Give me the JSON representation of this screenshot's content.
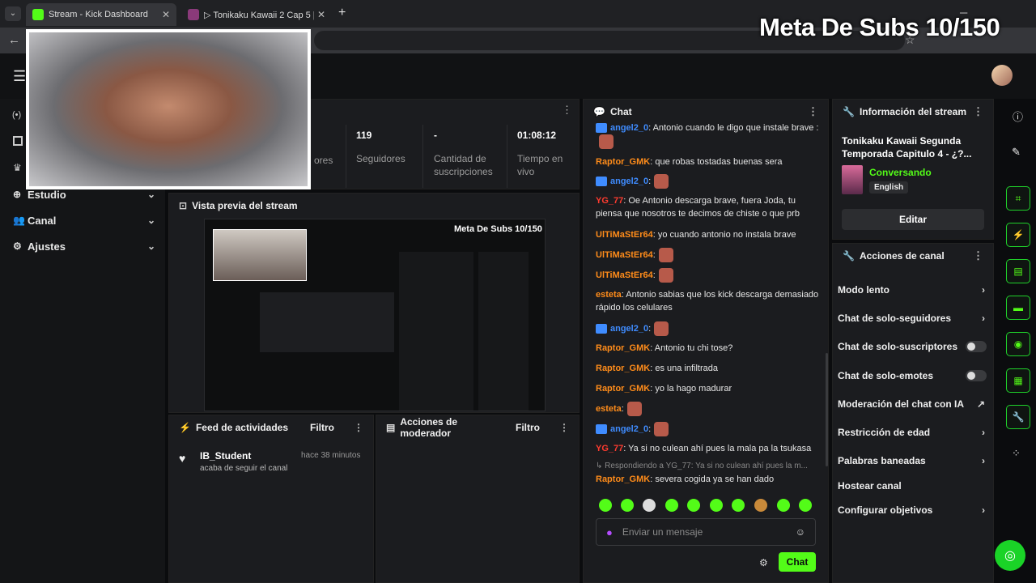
{
  "browser": {
    "tabs": [
      {
        "label": "Stream - Kick Dashboard"
      },
      {
        "label": "▷ Tonikaku Kawaii 2 Cap 5 [JAI"
      }
    ],
    "new_tab": "+"
  },
  "overlay": {
    "goal": "Meta De Subs 10/150"
  },
  "sidebar": {
    "items": [
      {
        "label": "Estudio"
      },
      {
        "label": "Canal"
      },
      {
        "label": "Ajustes"
      }
    ]
  },
  "stats": [
    {
      "value": "",
      "label": "ores"
    },
    {
      "value": "119",
      "label": "Seguidores"
    },
    {
      "value": "-",
      "label": "Cantidad de suscripciones"
    },
    {
      "value": "01:08:12",
      "label": "Tiempo en vivo"
    }
  ],
  "preview": {
    "title": "Vista previa del stream",
    "mini_goal": "Meta De Subs 10/150"
  },
  "activity": {
    "title": "Feed de actividades",
    "filter": "Filtro",
    "user": "IB_Student",
    "action": "acaba de seguir el canal",
    "time": "hace 38 minutos"
  },
  "moderator": {
    "title": "Acciones de moderador",
    "filter": "Filtro"
  },
  "chat": {
    "title": "Chat",
    "messages": [
      {
        "user": "angel2_0",
        "text": ": Antonio cuando le digo que instale brave :",
        "color": "#3f8cff",
        "badge": true
      },
      {
        "user": "Raptor_GMK",
        "text": ": que robas tostadas buenas sera",
        "color": "#ff8c1a",
        "badge": false
      },
      {
        "user": "angel2_0",
        "text": ":",
        "color": "#3f8cff",
        "badge": true
      },
      {
        "user": "YG_77",
        "text": ": Oe Antonio descarga brave, fuera Joda, tu piensa que nosotros te decimos de chiste o que prb",
        "color": "#ff3b2f",
        "badge": false
      },
      {
        "user": "UlTiMaStEr64",
        "text": ": yo cuando antonio no instala brave",
        "color": "#ff8c1a",
        "badge": false
      },
      {
        "user": "UlTiMaStEr64",
        "text": ":",
        "color": "#ff8c1a",
        "badge": false
      },
      {
        "user": "UlTiMaStEr64",
        "text": ":",
        "color": "#ff8c1a",
        "badge": false
      },
      {
        "user": "esteta",
        "text": ": Antonio sabias que los kick descarga demasiado rápido los celulares",
        "color": "#ff8c1a",
        "badge": false
      },
      {
        "user": "angel2_0",
        "text": ":",
        "color": "#3f8cff",
        "badge": true
      },
      {
        "user": "Raptor_GMK",
        "text": ": Antonio tu chi tose?",
        "color": "#ff8c1a",
        "badge": false
      },
      {
        "user": "Raptor_GMK",
        "text": ": es una infiltrada",
        "color": "#ff8c1a",
        "badge": false
      },
      {
        "user": "Raptor_GMK",
        "text": ": yo la hago madurar",
        "color": "#ff8c1a",
        "badge": false
      },
      {
        "user": "esteta",
        "text": ":",
        "color": "#ff8c1a",
        "badge": false
      },
      {
        "user": "angel2_0",
        "text": ":",
        "color": "#3f8cff",
        "badge": true
      },
      {
        "user": "YG_77",
        "text": ": Ya si no culean ahí pues la mala pa la tsukasa",
        "color": "#ff3b2f",
        "badge": false
      }
    ],
    "reply_to": "↳ Respondiendo a YG_77: Ya si no culean ahí pues la m...",
    "last": {
      "user": "Raptor_GMK",
      "text": ": severa cogida ya se han dado",
      "color": "#ff8c1a"
    },
    "placeholder": "Enviar un mensaje",
    "send": "Chat"
  },
  "info": {
    "title": "Información del stream",
    "stream_title": "Tonikaku Kawaii Segunda Temporada Capitulo 4 - ¿?...",
    "category": "Conversando",
    "language": "English",
    "edit": "Editar"
  },
  "actions": {
    "title": "Acciones de canal",
    "items": [
      {
        "label": "Modo lento",
        "type": "chev"
      },
      {
        "label": "Chat de solo-seguidores",
        "type": "chev"
      },
      {
        "label": "Chat de solo-suscriptores",
        "type": "toggle"
      },
      {
        "label": "Chat de solo-emotes",
        "type": "toggle"
      },
      {
        "label": "Moderación del chat con IA",
        "type": "ext"
      },
      {
        "label": "Restricción de edad",
        "type": "chev"
      },
      {
        "label": "Palabras baneadas",
        "type": "chev"
      },
      {
        "label": "Hostear canal",
        "type": "none"
      },
      {
        "label": "Configurar objetivos",
        "type": "chev"
      }
    ]
  },
  "colors": {
    "accent": "#53fc18",
    "panel": "#1b1c1f",
    "bg": "#0b0c0e"
  }
}
